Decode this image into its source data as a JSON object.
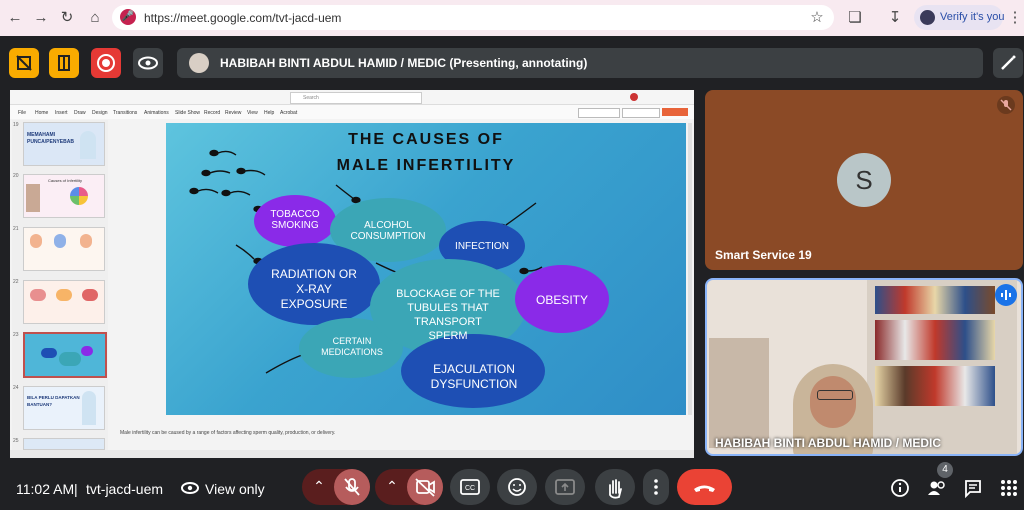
{
  "browser": {
    "url": "https://meet.google.com/tvt-jacd-uem",
    "profile_label": "Verify it's you"
  },
  "top_bar": {
    "presenter_label": "HABIBAH BINTI ABDUL HAMID / MEDIC (Presenting, annotating)"
  },
  "slide": {
    "title_line1": "THE CAUSES OF",
    "title_line2": "MALE INFERTILITY",
    "bubbles": {
      "tobacco_line1": "TOBACCO",
      "tobacco_line2": "SMOKING",
      "alcohol_line1": "ALCOHOL",
      "alcohol_line2": "CONSUMPTION",
      "infection": "INFECTION",
      "radiation_line1": "RADIATION OR",
      "radiation_line2": "X-RAY",
      "radiation_line3": "EXPOSURE",
      "blockage_line1": "BLOCKAGE OF THE",
      "blockage_line2": "TUBULES THAT",
      "blockage_line3": "TRANSPORT",
      "blockage_line4": "SPERM",
      "obesity": "OBESITY",
      "medications_line1": "CERTAIN",
      "medications_line2": "MEDICATIONS",
      "ejaculation_line1": "EJACULATION",
      "ejaculation_line2": "DYSFUNCTION"
    }
  },
  "ppt": {
    "menu": [
      "File",
      "Home",
      "Insert",
      "Draw",
      "Design",
      "Transitions",
      "Animations",
      "Slide Show",
      "Record",
      "Review",
      "View",
      "Help",
      "Acrobat"
    ],
    "search_placeholder": "Search",
    "thumb_numbers": [
      "19",
      "20",
      "21",
      "22",
      "23",
      "24",
      "25"
    ],
    "thumb1_text_line1": "MEMAHAMI",
    "thumb1_text_line2": "PUNCA/PENYEBAB",
    "thumb2_text": "Causes of Infertility",
    "thumb6_text_line1": "BILA PERLU DAPATKAN",
    "thumb6_text_line2": "BANTUAN?",
    "notes_text": "Male infertility can be caused by a range of factors affecting sperm quality, production, or delivery."
  },
  "participants": [
    {
      "name": "Smart Service 19",
      "initial": "S"
    },
    {
      "name": "HABIBAH BINTI ABDUL HAMID / MEDIC"
    }
  ],
  "bottom_bar": {
    "time": "11:02 AM",
    "separator": "|",
    "meeting_code": "tvt-jacd-uem",
    "view_only_label": "View only",
    "people_count": "4"
  },
  "colors": {
    "end_call": "#ea4335",
    "muted_control": "#5a1e1e",
    "muted_control_inner": "#b65c5c",
    "dark_bubble": "#1e4fb4",
    "teal_bubble": "#3ba6b6",
    "purple_bubble": "#8a2ae8"
  }
}
